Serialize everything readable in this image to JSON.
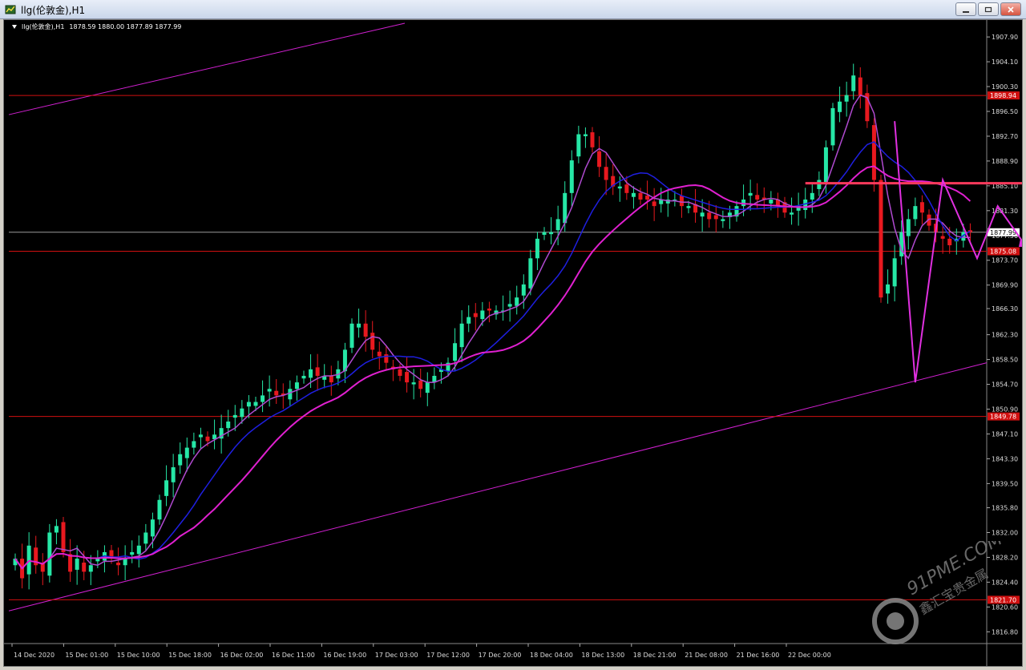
{
  "window": {
    "title": "llg(伦敦金),H1",
    "buttons": [
      "minimize-button",
      "restore-button",
      "close-button"
    ]
  },
  "chart_header": {
    "symbol": "llg(伦敦金),H1",
    "ohlc": "1878.59 1880.00 1877.89 1877.99"
  },
  "watermark": {
    "brand": "91PME.COM",
    "cn": "鑫汇宝贵金属"
  },
  "colors": {
    "background": "#000000",
    "bull": "#26e7a6",
    "bear": "#e8191f",
    "ma_fast": "#b04ad0",
    "ma_mid": "#1f1fe0",
    "ma_slow": "#e020d0",
    "hline": "#d01010",
    "resistance": "#ff3a5c",
    "trendline": "#d020d0",
    "arrow": "#e030e0"
  },
  "chart_data": {
    "type": "candlestick",
    "ylim": [
      1815.0,
      1910.0
    ],
    "yticks": [
      "1907.90",
      "1904.10",
      "1900.30",
      "1896.50",
      "1892.70",
      "1888.90",
      "1885.10",
      "1881.30",
      "1877.50",
      "1873.70",
      "1869.90",
      "1866.30",
      "1862.30",
      "1858.50",
      "1854.70",
      "1850.90",
      "1847.10",
      "1843.30",
      "1839.50",
      "1835.80",
      "1832.00",
      "1828.20",
      "1824.40",
      "1820.60",
      "1816.80"
    ],
    "xticks": [
      "14 Dec 2020",
      "15 Dec 01:00",
      "15 Dec 10:00",
      "15 Dec 18:00",
      "16 Dec 02:00",
      "16 Dec 11:00",
      "16 Dec 19:00",
      "17 Dec 03:00",
      "17 Dec 12:00",
      "17 Dec 20:00",
      "18 Dec 04:00",
      "18 Dec 13:00",
      "18 Dec 21:00",
      "21 Dec 08:00",
      "21 Dec 16:00",
      "22 Dec 00:00"
    ],
    "current_price": "1877.99",
    "current_value": 1877.99,
    "horizontal_levels": [
      {
        "label": "1898.94",
        "value": 1898.94
      },
      {
        "label": "1875.08",
        "value": 1875.08
      },
      {
        "label": "1849.78",
        "value": 1849.78
      },
      {
        "label": "1821.70",
        "value": 1821.7
      }
    ],
    "resistance_level": 1885.5,
    "closes": [
      1828,
      1825,
      1830,
      1827,
      1826,
      1832,
      1833,
      1829,
      1826,
      1828,
      1826,
      1827,
      1828,
      1829,
      1828,
      1827,
      1828,
      1829,
      1830,
      1832,
      1834,
      1837,
      1840,
      1842,
      1844,
      1845,
      1846,
      1847,
      1846,
      1847,
      1848,
      1849,
      1850,
      1851,
      1852,
      1852,
      1853,
      1854,
      1853,
      1853,
      1854,
      1855,
      1856,
      1857,
      1856,
      1856,
      1855,
      1857,
      1860,
      1864,
      1864,
      1862,
      1860,
      1859,
      1858,
      1857,
      1856,
      1855,
      1855,
      1854,
      1855,
      1856,
      1857,
      1858,
      1861,
      1864,
      1865,
      1865,
      1866,
      1866,
      1866,
      1866,
      1867,
      1868,
      1870,
      1874,
      1877,
      1878,
      1878,
      1880,
      1884,
      1889,
      1893,
      1893,
      1891,
      1888,
      1886,
      1885,
      1885,
      1884,
      1884,
      1883,
      1883,
      1882,
      1883,
      1883,
      1883,
      1882,
      1882,
      1881,
      1881,
      1880,
      1880,
      1880,
      1881,
      1882,
      1883,
      1884,
      1883,
      1883,
      1883,
      1882,
      1881,
      1881,
      1882,
      1883,
      1884,
      1886,
      1891,
      1897,
      1898,
      1899,
      1902,
      1899,
      1895,
      1886,
      1868,
      1870,
      1874,
      1878,
      1880,
      1882,
      1881,
      1879,
      1878,
      1877,
      1876,
      1877,
      1878,
      1878
    ]
  }
}
